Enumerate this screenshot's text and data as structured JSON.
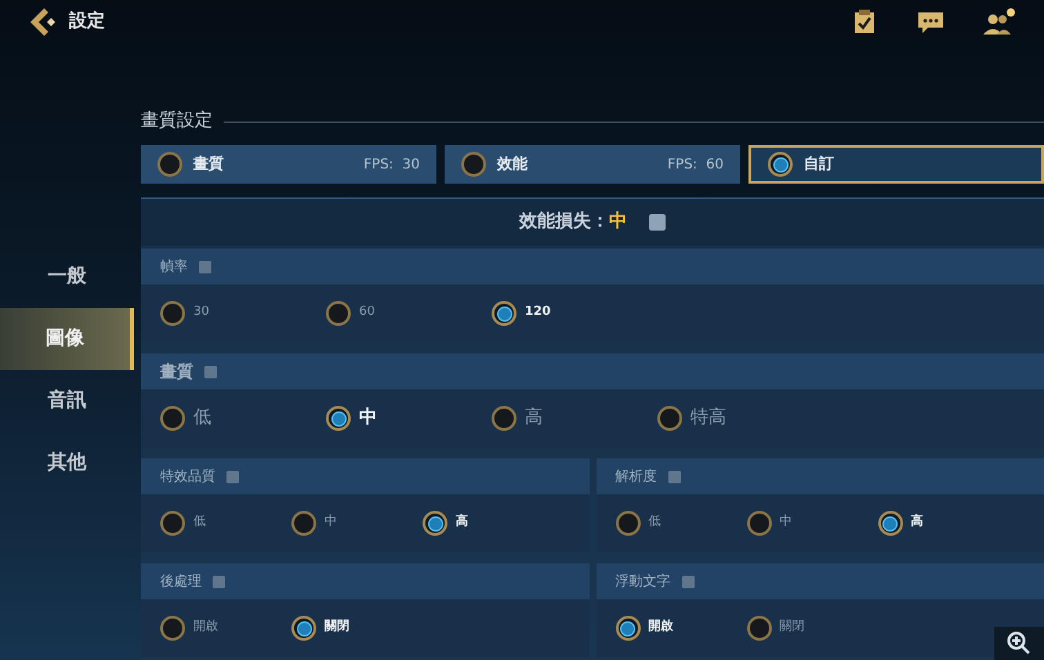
{
  "header": {
    "title": "設定"
  },
  "sidebar": {
    "items": [
      {
        "label": "一般",
        "selected": false
      },
      {
        "label": "圖像",
        "selected": true
      },
      {
        "label": "音訊",
        "selected": false
      },
      {
        "label": "其他",
        "selected": false
      }
    ]
  },
  "section_title": "畫質設定",
  "presets": [
    {
      "label": "畫質",
      "fps": "FPS:  30",
      "selected": false
    },
    {
      "label": "效能",
      "fps": "FPS:  60",
      "selected": false
    },
    {
      "label": "自訂",
      "selected": true
    }
  ],
  "perf_loss": {
    "label": "效能損失：",
    "value": "中"
  },
  "rows": [
    [
      {
        "title": "幀率",
        "options": [
          {
            "label": "30",
            "selected": false
          },
          {
            "label": "60",
            "selected": false
          },
          {
            "label": "120",
            "selected": true
          }
        ]
      }
    ],
    [
      {
        "title": "畫質",
        "options": [
          {
            "label": "低",
            "selected": false
          },
          {
            "label": "中",
            "selected": true
          },
          {
            "label": "高",
            "selected": false
          },
          {
            "label": "特高",
            "selected": false
          }
        ]
      }
    ],
    [
      {
        "title": "特效品質",
        "options": [
          {
            "label": "低",
            "selected": false
          },
          {
            "label": "中",
            "selected": false
          },
          {
            "label": "高",
            "selected": true
          }
        ]
      },
      {
        "title": "解析度",
        "options": [
          {
            "label": "低",
            "selected": false
          },
          {
            "label": "中",
            "selected": false
          },
          {
            "label": "高",
            "selected": true
          }
        ]
      }
    ],
    [
      {
        "title": "後處理",
        "options": [
          {
            "label": "開啟",
            "selected": false
          },
          {
            "label": "關閉",
            "selected": true
          }
        ]
      },
      {
        "title": "浮動文字",
        "options": [
          {
            "label": "開啟",
            "selected": true
          },
          {
            "label": "關閉",
            "selected": false
          }
        ]
      }
    ]
  ]
}
